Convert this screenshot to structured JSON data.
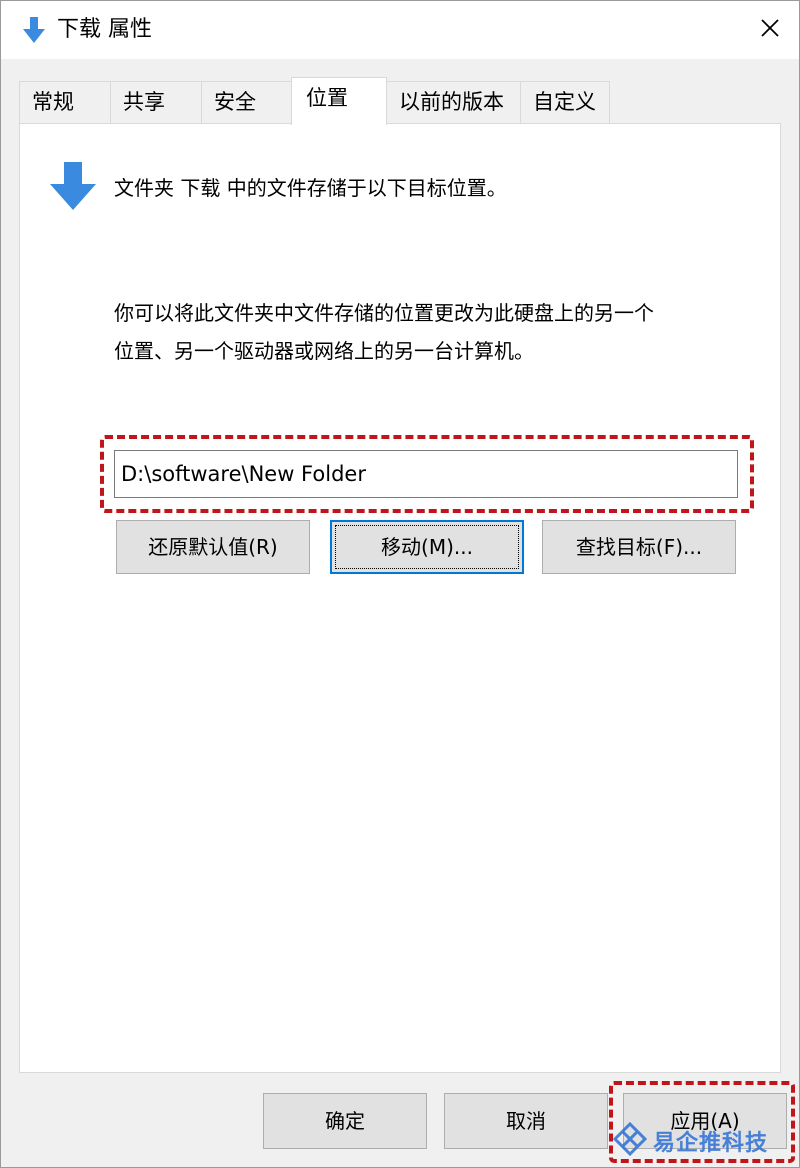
{
  "window": {
    "title": "下载 属性",
    "title_icon": "download-arrow-icon",
    "close_icon": "close-icon",
    "accent_color": "#0078d7",
    "arrow_color": "#3a8be0"
  },
  "tabs": [
    {
      "label": "常规",
      "active": false
    },
    {
      "label": "共享",
      "active": false
    },
    {
      "label": "安全",
      "active": false
    },
    {
      "label": "位置",
      "active": true
    },
    {
      "label": "以前的版本",
      "active": false
    },
    {
      "label": "自定义",
      "active": false
    }
  ],
  "location": {
    "description": "文件夹 下载 中的文件存储于以下目标位置。",
    "paragraph_line1": "你可以将此文件夹中文件存储的位置更改为此硬盘上的另一个",
    "paragraph_line2": "位置、另一个驱动器或网络上的另一台计算机。",
    "path_value": "D:\\software\\New Folder",
    "restore_label": "还原默认值(R)",
    "move_label": "移动(M)...",
    "find_label": "查找目标(F)..."
  },
  "footer": {
    "ok_label": "确定",
    "cancel_label": "取消",
    "apply_label": "应用(A)"
  },
  "annotations": {
    "highlight_color": "#c0161b"
  },
  "watermark": {
    "text": "易企推科技",
    "icon": "diamond-logo-icon",
    "color": "#2b6fd6"
  }
}
